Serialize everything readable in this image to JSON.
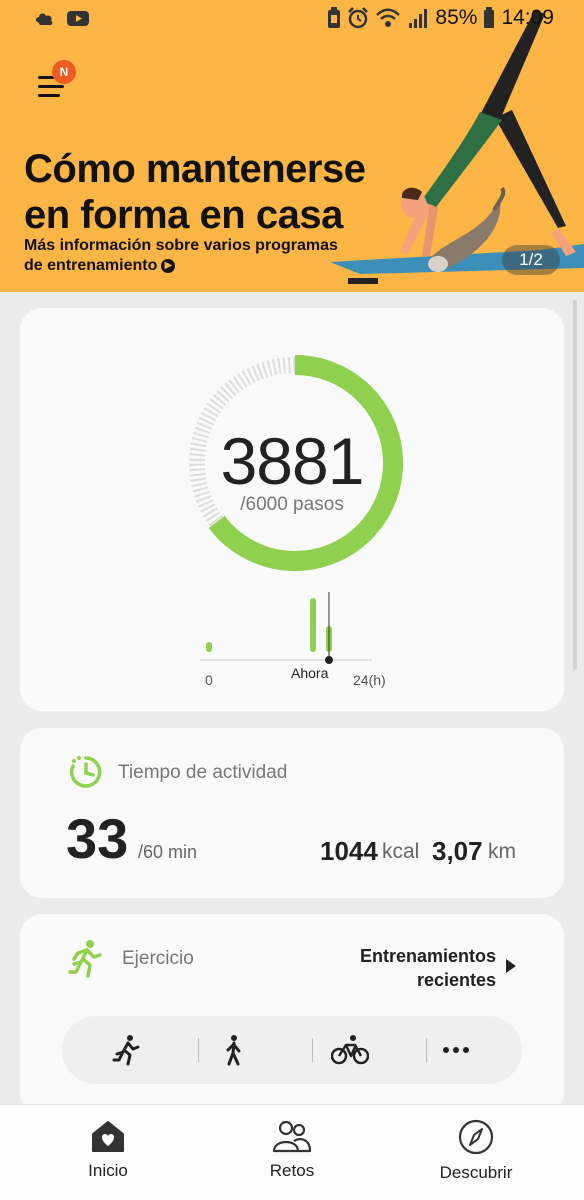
{
  "status_bar": {
    "battery_percent": "85%",
    "time": "14:09",
    "left_icons": [
      "weather-icon",
      "youtube-icon"
    ],
    "right_icons": [
      "battery-saver-icon",
      "alarm-icon",
      "wifi-icon",
      "signal-icon",
      "battery-icon"
    ]
  },
  "header": {
    "menu_badge": "N"
  },
  "banner": {
    "title_line1": "Cómo mantenerse",
    "title_line2": "en forma en casa",
    "subtitle_line1": "Más información sobre varios programas",
    "subtitle_line2": "de entrenamiento",
    "pager": "1/2",
    "background": "#fdb646"
  },
  "steps": {
    "count": "3881",
    "goal": "/6000 pasos",
    "progress": 0.647,
    "axis_start": "0",
    "axis_now": "Ahora",
    "axis_end": "24(h)",
    "accent": "#8fd14f"
  },
  "activity": {
    "label": "Tiempo de actividad",
    "minutes": "33",
    "minutes_goal": "/60 min",
    "kcal_value": "1044",
    "kcal_unit": "kcal",
    "km_value": "3,07",
    "km_unit": "km"
  },
  "exercise": {
    "label": "Ejercicio",
    "recent_line1": "Entrenamientos",
    "recent_line2": "recientes",
    "quick_buttons": [
      "run-icon",
      "walk-icon",
      "bike-icon",
      "more-icon"
    ]
  },
  "bottom_nav": {
    "items": [
      {
        "label": "Inicio",
        "icon": "home-heart-icon"
      },
      {
        "label": "Retos",
        "icon": "people-icon"
      },
      {
        "label": "Descubrir",
        "icon": "compass-icon"
      }
    ]
  }
}
